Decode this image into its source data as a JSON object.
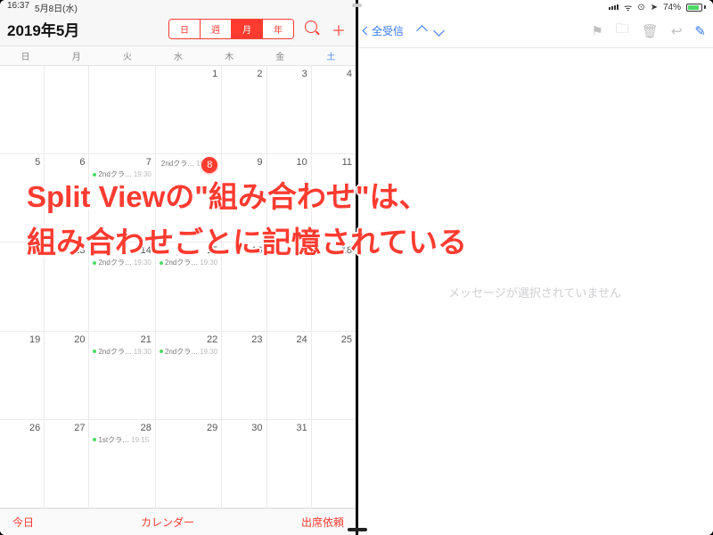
{
  "status": {
    "time": "16:37",
    "date": "5月8日(水)",
    "battery": "74%"
  },
  "calendar": {
    "title": "2019年5月",
    "segments": [
      "日",
      "週",
      "月",
      "年"
    ],
    "segment_selected": 2,
    "weekday": [
      "日",
      "月",
      "火",
      "水",
      "木",
      "金",
      "土"
    ],
    "footer": {
      "today": "今日",
      "calendars": "カレンダー",
      "inbox": "出席依頼"
    },
    "weeks": [
      [
        {
          "n": "",
          "dim": true
        },
        {
          "n": "",
          "dim": true
        },
        {
          "n": "",
          "dim": true
        },
        {
          "n": "1"
        },
        {
          "n": "2"
        },
        {
          "n": "3"
        },
        {
          "n": "4"
        }
      ],
      [
        {
          "n": "5"
        },
        {
          "n": "6"
        },
        {
          "n": "7",
          "ev": "2ndクラ…",
          "ts": "19:30"
        },
        {
          "n": "8",
          "today": true,
          "ev": "2ndクラ…",
          "ts": "19:30"
        },
        {
          "n": "9"
        },
        {
          "n": "10"
        },
        {
          "n": "11"
        }
      ],
      [
        {
          "n": "12"
        },
        {
          "n": "13"
        },
        {
          "n": "14",
          "ev": "2ndクラ…",
          "ts": "19:30"
        },
        {
          "n": "15",
          "ev": "2ndクラ…",
          "ts": "19:30"
        },
        {
          "n": "16"
        },
        {
          "n": "17"
        },
        {
          "n": "18"
        }
      ],
      [
        {
          "n": "19"
        },
        {
          "n": "20"
        },
        {
          "n": "21",
          "ev": "2ndクラ…",
          "ts": "19:30"
        },
        {
          "n": "22",
          "ev": "2ndクラ…",
          "ts": "19:30"
        },
        {
          "n": "23"
        },
        {
          "n": "24"
        },
        {
          "n": "25"
        }
      ],
      [
        {
          "n": "26"
        },
        {
          "n": "27"
        },
        {
          "n": "28",
          "ev": "1stクラ…",
          "ts": "19:15"
        },
        {
          "n": "29"
        },
        {
          "n": "30"
        },
        {
          "n": "31"
        },
        {
          "n": "",
          "dim": true
        }
      ]
    ]
  },
  "mail": {
    "back": "全受信",
    "empty": "メッセージが選択されていません",
    "icons": {
      "flag": "⚑",
      "folder": "🗀",
      "trash": "🗑",
      "reply": "↩",
      "compose": "✎"
    }
  },
  "overlay": {
    "line1": "Split Viewの\"組み合わせ\"は、",
    "line2": "組み合わせごとに記憶されている"
  }
}
